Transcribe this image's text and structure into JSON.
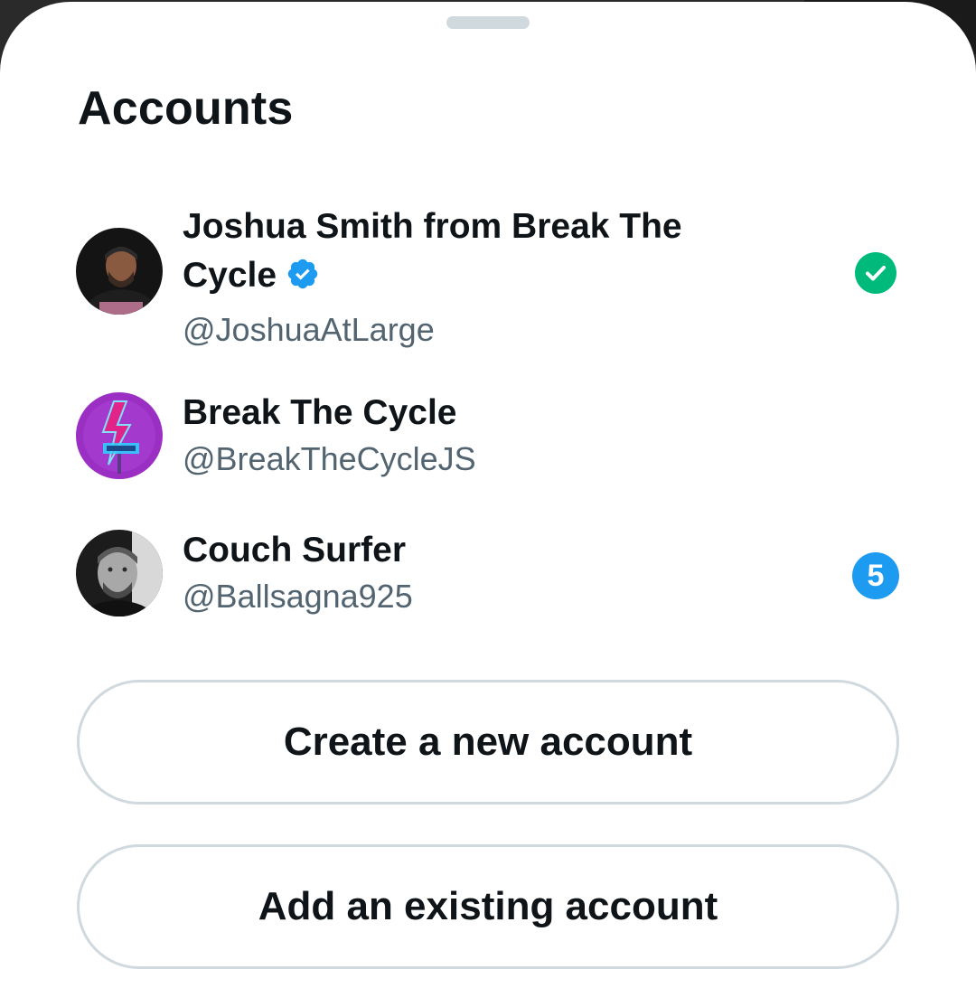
{
  "sheet": {
    "title": "Accounts"
  },
  "accounts": [
    {
      "name": "Joshua Smith from Break The Cycle",
      "handle": "@JoshuaAtLarge",
      "verified": true,
      "active": true,
      "avatar_icon": "user-photo-avatar"
    },
    {
      "name": "Break The Cycle",
      "handle": "@BreakTheCycleJS",
      "verified": false,
      "active": false,
      "avatar_icon": "neon-sign-logo-avatar"
    },
    {
      "name": "Couch Surfer",
      "handle": "@Ballsagna925",
      "verified": false,
      "active": false,
      "notification_count": "5",
      "avatar_icon": "user-photo-avatar"
    }
  ],
  "actions": {
    "create_label": "Create a new account",
    "add_existing_label": "Add an existing account"
  },
  "colors": {
    "verified_blue": "#1d9bf0",
    "active_green": "#00ba7c",
    "text_primary": "#0f1419",
    "text_secondary": "#536471",
    "border": "#cfd9de"
  }
}
